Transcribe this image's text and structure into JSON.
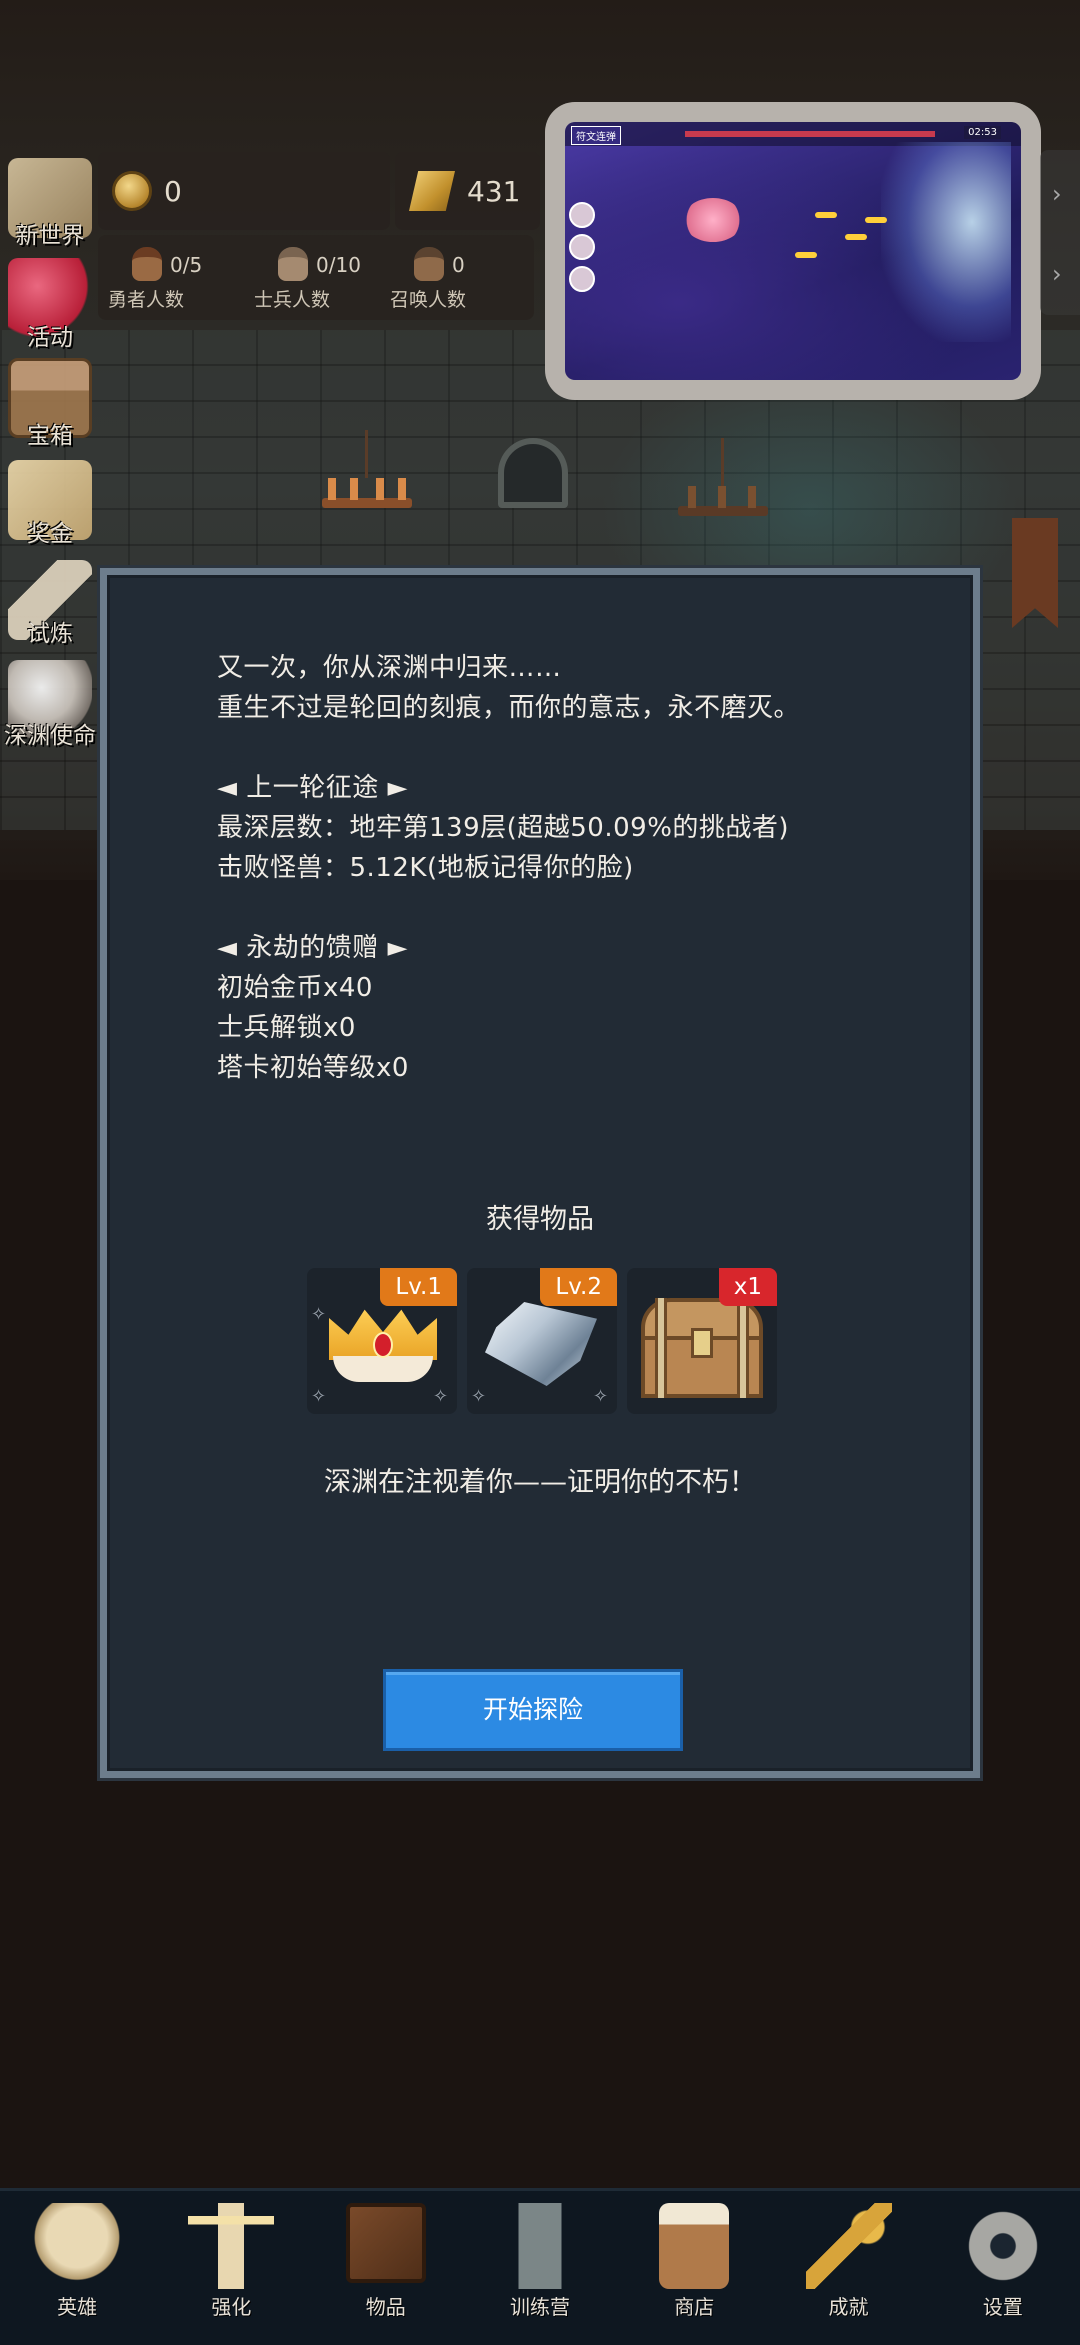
{
  "resources": {
    "gold": "0",
    "bars": "431"
  },
  "counts": [
    {
      "value": "0/5",
      "label": "勇者人数"
    },
    {
      "value": "0/10",
      "label": "士兵人数"
    },
    {
      "value": "0",
      "label": "召唤人数"
    }
  ],
  "side_menu": [
    {
      "label": "新世界",
      "icon": "map-scroll-icon"
    },
    {
      "label": "活动",
      "icon": "heart-icon"
    },
    {
      "label": "宝箱",
      "icon": "chest-icon"
    },
    {
      "label": "奖金",
      "icon": "envelope-icon"
    },
    {
      "label": "试炼",
      "icon": "feather-icon"
    },
    {
      "label": "深渊使命",
      "icon": "pearl-icon"
    }
  ],
  "video": {
    "tag": "符文连弹",
    "time": "02:53"
  },
  "dialog": {
    "lines": [
      "又一次，你从深渊中归来……",
      "重生不过是轮回的刻痕，而你的意志，永不磨灭。",
      "◄ 上一轮征途 ►",
      "最深层数：地牢第139层(超越50.09%的挑战者)",
      "击败怪兽：5.12K(地板记得你的脸)",
      "◄ 永劫的馈赠 ►",
      "初始金币x40",
      "士兵解锁x0",
      "塔卡初始等级x0"
    ],
    "reward_title": "获得物品",
    "items": [
      {
        "name": "crown",
        "badge": "Lv.1",
        "badge_color": "#e17919"
      },
      {
        "name": "diamond",
        "badge": "Lv.2",
        "badge_color": "#e17919"
      },
      {
        "name": "chest",
        "badge": "x1",
        "badge_color": "#d8262c"
      }
    ],
    "slogan": "深渊在注视着你——证明你的不朽！",
    "start_button": "开始探险"
  },
  "nav": [
    {
      "label": "英雄",
      "icon": "skull-icon"
    },
    {
      "label": "强化",
      "icon": "candle-icon"
    },
    {
      "label": "物品",
      "icon": "book-icon"
    },
    {
      "label": "训练营",
      "icon": "lantern-icon"
    },
    {
      "label": "商店",
      "icon": "mug-icon"
    },
    {
      "label": "成就",
      "icon": "key-icon"
    },
    {
      "label": "设置",
      "icon": "gear-icon"
    }
  ],
  "colors": {
    "accent_button": "#2c8ae3",
    "badge_orange": "#e17919",
    "badge_red": "#d8262c",
    "dialog_bg": "#222b35"
  }
}
